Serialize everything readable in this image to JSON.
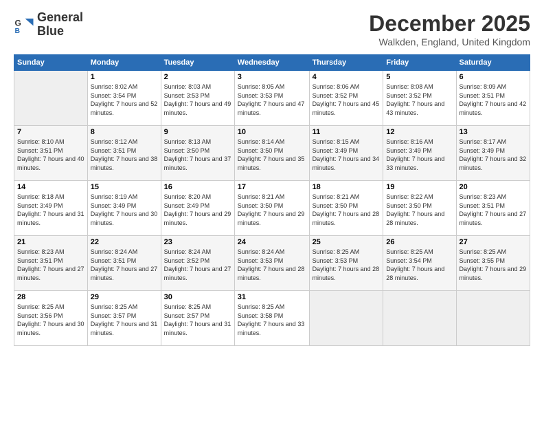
{
  "header": {
    "logo_line1": "General",
    "logo_line2": "Blue",
    "month_title": "December 2025",
    "subtitle": "Walkden, England, United Kingdom"
  },
  "days_of_week": [
    "Sunday",
    "Monday",
    "Tuesday",
    "Wednesday",
    "Thursday",
    "Friday",
    "Saturday"
  ],
  "weeks": [
    [
      {
        "day": "",
        "empty": true
      },
      {
        "day": "1",
        "sunrise": "8:02 AM",
        "sunset": "3:54 PM",
        "daylight": "7 hours and 52 minutes."
      },
      {
        "day": "2",
        "sunrise": "8:03 AM",
        "sunset": "3:53 PM",
        "daylight": "7 hours and 49 minutes."
      },
      {
        "day": "3",
        "sunrise": "8:05 AM",
        "sunset": "3:53 PM",
        "daylight": "7 hours and 47 minutes."
      },
      {
        "day": "4",
        "sunrise": "8:06 AM",
        "sunset": "3:52 PM",
        "daylight": "7 hours and 45 minutes."
      },
      {
        "day": "5",
        "sunrise": "8:08 AM",
        "sunset": "3:52 PM",
        "daylight": "7 hours and 43 minutes."
      },
      {
        "day": "6",
        "sunrise": "8:09 AM",
        "sunset": "3:51 PM",
        "daylight": "7 hours and 42 minutes."
      }
    ],
    [
      {
        "day": "7",
        "sunrise": "8:10 AM",
        "sunset": "3:51 PM",
        "daylight": "7 hours and 40 minutes."
      },
      {
        "day": "8",
        "sunrise": "8:12 AM",
        "sunset": "3:51 PM",
        "daylight": "7 hours and 38 minutes."
      },
      {
        "day": "9",
        "sunrise": "8:13 AM",
        "sunset": "3:50 PM",
        "daylight": "7 hours and 37 minutes."
      },
      {
        "day": "10",
        "sunrise": "8:14 AM",
        "sunset": "3:50 PM",
        "daylight": "7 hours and 35 minutes."
      },
      {
        "day": "11",
        "sunrise": "8:15 AM",
        "sunset": "3:49 PM",
        "daylight": "7 hours and 34 minutes."
      },
      {
        "day": "12",
        "sunrise": "8:16 AM",
        "sunset": "3:49 PM",
        "daylight": "7 hours and 33 minutes."
      },
      {
        "day": "13",
        "sunrise": "8:17 AM",
        "sunset": "3:49 PM",
        "daylight": "7 hours and 32 minutes."
      }
    ],
    [
      {
        "day": "14",
        "sunrise": "8:18 AM",
        "sunset": "3:49 PM",
        "daylight": "7 hours and 31 minutes."
      },
      {
        "day": "15",
        "sunrise": "8:19 AM",
        "sunset": "3:49 PM",
        "daylight": "7 hours and 30 minutes."
      },
      {
        "day": "16",
        "sunrise": "8:20 AM",
        "sunset": "3:49 PM",
        "daylight": "7 hours and 29 minutes."
      },
      {
        "day": "17",
        "sunrise": "8:21 AM",
        "sunset": "3:50 PM",
        "daylight": "7 hours and 29 minutes."
      },
      {
        "day": "18",
        "sunrise": "8:21 AM",
        "sunset": "3:50 PM",
        "daylight": "7 hours and 28 minutes."
      },
      {
        "day": "19",
        "sunrise": "8:22 AM",
        "sunset": "3:50 PM",
        "daylight": "7 hours and 28 minutes."
      },
      {
        "day": "20",
        "sunrise": "8:23 AM",
        "sunset": "3:51 PM",
        "daylight": "7 hours and 27 minutes."
      }
    ],
    [
      {
        "day": "21",
        "sunrise": "8:23 AM",
        "sunset": "3:51 PM",
        "daylight": "7 hours and 27 minutes."
      },
      {
        "day": "22",
        "sunrise": "8:24 AM",
        "sunset": "3:51 PM",
        "daylight": "7 hours and 27 minutes."
      },
      {
        "day": "23",
        "sunrise": "8:24 AM",
        "sunset": "3:52 PM",
        "daylight": "7 hours and 27 minutes."
      },
      {
        "day": "24",
        "sunrise": "8:24 AM",
        "sunset": "3:53 PM",
        "daylight": "7 hours and 28 minutes."
      },
      {
        "day": "25",
        "sunrise": "8:25 AM",
        "sunset": "3:53 PM",
        "daylight": "7 hours and 28 minutes."
      },
      {
        "day": "26",
        "sunrise": "8:25 AM",
        "sunset": "3:54 PM",
        "daylight": "7 hours and 28 minutes."
      },
      {
        "day": "27",
        "sunrise": "8:25 AM",
        "sunset": "3:55 PM",
        "daylight": "7 hours and 29 minutes."
      }
    ],
    [
      {
        "day": "28",
        "sunrise": "8:25 AM",
        "sunset": "3:56 PM",
        "daylight": "7 hours and 30 minutes."
      },
      {
        "day": "29",
        "sunrise": "8:25 AM",
        "sunset": "3:57 PM",
        "daylight": "7 hours and 31 minutes."
      },
      {
        "day": "30",
        "sunrise": "8:25 AM",
        "sunset": "3:57 PM",
        "daylight": "7 hours and 31 minutes."
      },
      {
        "day": "31",
        "sunrise": "8:25 AM",
        "sunset": "3:58 PM",
        "daylight": "7 hours and 33 minutes."
      },
      {
        "day": "",
        "empty": true
      },
      {
        "day": "",
        "empty": true
      },
      {
        "day": "",
        "empty": true
      }
    ]
  ]
}
